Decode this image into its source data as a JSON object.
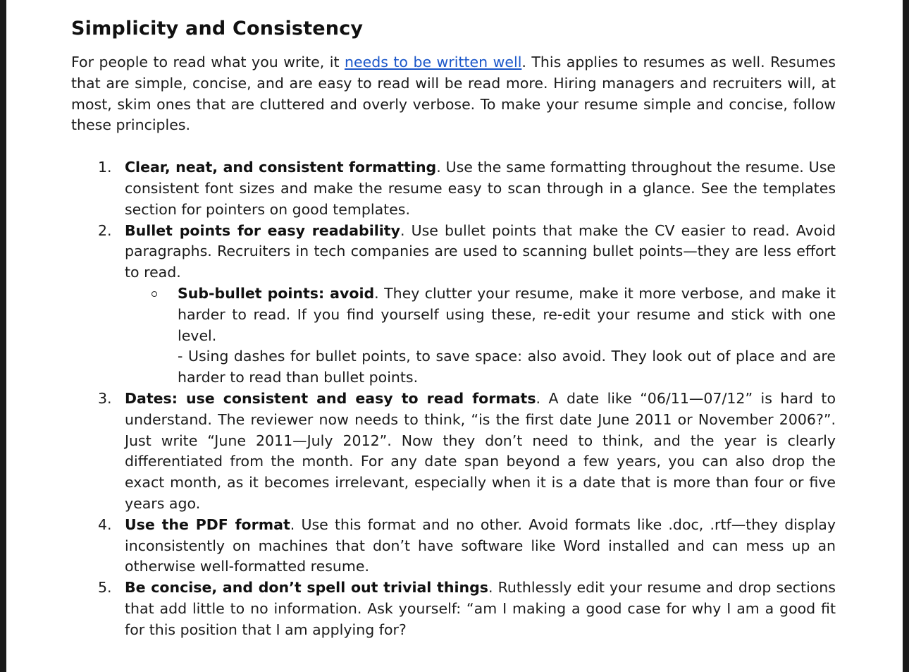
{
  "heading": "Simplicity and Consistency",
  "intro": {
    "before_link": "For people to read what you write, it ",
    "link_text": "needs to be written well",
    "after_link": ". This applies to resumes as well. Resumes that are simple, concise, and are easy to read will be read more. Hiring managers and recruiters will, at most, skim ones that are cluttered and overly verbose. To make your resume simple and concise, follow these principles."
  },
  "principles": [
    {
      "number": "1.",
      "lead": "Clear, neat, and consistent formatting",
      "text": ". Use the same formatting throughout the resume. Use consistent font sizes and make the resume easy to scan through in a glance. See the templates section for pointers on good templates."
    },
    {
      "number": "2.",
      "lead": "Bullet points for easy readability",
      "text": ". Use bullet points that make the CV easier to read. Avoid paragraphs. Recruiters in tech companies are used to scanning bullet points—they are less effort to read.",
      "sub": {
        "lead": "Sub-bullet points: avoid",
        "text": ". They clutter your resume, make it more verbose, and make it harder to read. If you find yourself using these, re-edit your resume and stick with one level."
      },
      "dash_note": "- Using dashes for bullet points, to save space: also avoid. They look out of place and are harder to read than bullet points."
    },
    {
      "number": "3.",
      "lead": "Dates: use consistent and easy to read formats",
      "text": ". A date like “06/11—07/12” is hard to understand. The reviewer now needs to think, “is the first date June 2011 or November 2006?”. Just write “June 2011—July 2012”. Now they don’t need to think, and the year is clearly differentiated from the month. For any date span beyond a few years, you can also drop the exact month, as it becomes irrelevant, especially when it is a date that is more than four or five years ago."
    },
    {
      "number": "4.",
      "lead": "Use the PDF format",
      "text": ". Use this format and no other. Avoid formats like .doc, .rtf—they display inconsistently on machines that don’t have software like Word installed and can mess up an otherwise well-formatted resume."
    },
    {
      "number": "5.",
      "lead": "Be concise, and don’t spell out trivial things",
      "text": ". Ruthlessly edit your resume and drop sections that add little to no information. Ask yourself: “am I making a good case for why I am a good fit for this position that I am applying for?"
    }
  ]
}
